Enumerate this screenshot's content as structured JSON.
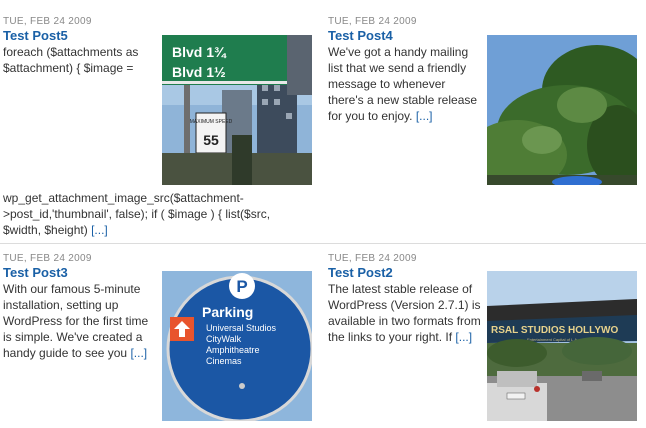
{
  "posts": [
    {
      "date": "TUE, FEB 24 2009",
      "title": "Test Post5",
      "excerpt_top": "foreach ($attachments as $attachment) { $image =",
      "excerpt_bottom": "wp_get_attachment_image_src($attachment->post_id,'thumbnail', false); if ( $image ) { list($src, $width, $height)",
      "more": "[...]",
      "sign_line1": "Blvd 1½",
      "sign_top": "Blvd 1¾",
      "speed_label": "MAXIMUM SPEED",
      "speed_value": "55"
    },
    {
      "date": "TUE, FEB 24 2009",
      "title": "Test Post4",
      "excerpt": "We've got a handy mailing list that we send a friendly message to whenever there's a new stable release for you to enjoy.",
      "more": "[...]"
    },
    {
      "date": "TUE, FEB 24 2009",
      "title": "Test Post3",
      "excerpt": "With our famous 5-minute installation, setting up WordPress for the first time is simple. We've created a handy guide to see you",
      "more": "[...]",
      "sign_title": "Parking",
      "sign_lines": [
        "Universal Studios",
        "CityWalk",
        "Amphitheatre",
        "Cinemas"
      ],
      "sign_p": "P"
    },
    {
      "date": "TUE, FEB 24 2009",
      "title": "Test Post2",
      "excerpt": "The latest stable release of WordPress (Version 2.7.1) is available in two formats from the links to your right. If",
      "more": "[...]",
      "gate_text": "RSAL STUDIOS HOLLYWO",
      "gate_sub": "Entertainment Capital of L.A."
    }
  ]
}
